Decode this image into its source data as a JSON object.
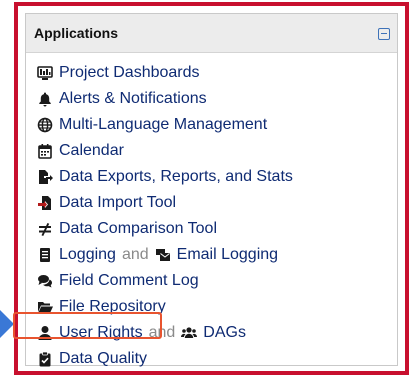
{
  "panel": {
    "title": "Applications"
  },
  "items": [
    {
      "label": "Project Dashboards",
      "icon": "dashboard-icon"
    },
    {
      "label": "Alerts & Notifications",
      "icon": "bell-icon"
    },
    {
      "label": "Multi-Language Management",
      "icon": "globe-icon"
    },
    {
      "label": "Calendar",
      "icon": "calendar-icon"
    },
    {
      "label": "Data Exports, Reports, and Stats",
      "icon": "file-export-icon"
    },
    {
      "label": "Data Import Tool",
      "icon": "file-import-icon"
    },
    {
      "label": "Data Comparison Tool",
      "icon": "not-equal-icon"
    },
    {
      "label": "Logging",
      "connector": "and",
      "label2": "Email Logging",
      "icon": "logging-icon",
      "icon2": "mail-bulk-icon"
    },
    {
      "label": "Field Comment Log",
      "icon": "comments-icon"
    },
    {
      "label": "File Repository",
      "icon": "folder-open-icon"
    },
    {
      "label": "User Rights",
      "connector": "and",
      "label2": "DAGs",
      "icon": "user-icon",
      "icon2": "users-icon"
    },
    {
      "label": "Data Quality",
      "icon": "clipboard-check-icon"
    }
  ],
  "colors": {
    "link": "#0f2b73",
    "highlight": "#e8542f",
    "frame": "#c8102e",
    "arrow": "#3a78d6"
  }
}
